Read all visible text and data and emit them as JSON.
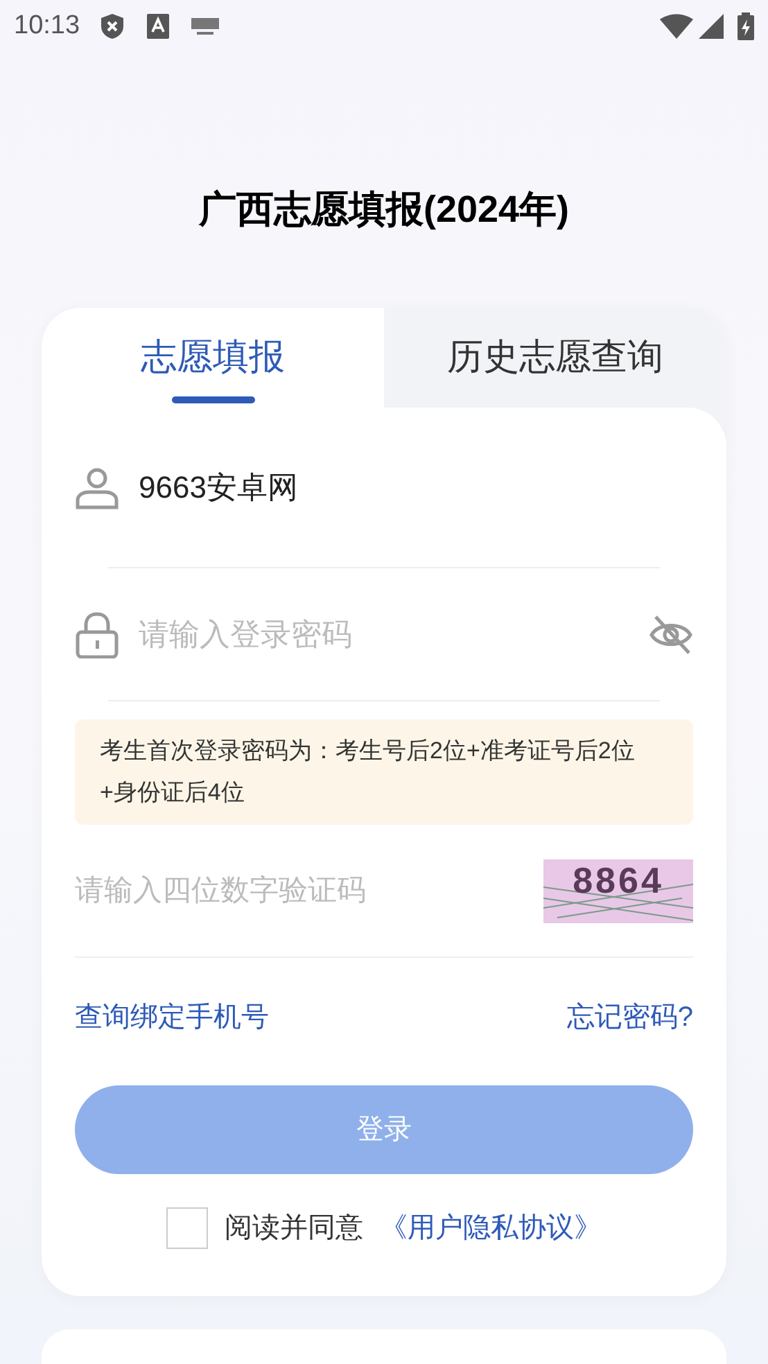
{
  "status_bar": {
    "time": "10:13"
  },
  "title": "广西志愿填报(2024年)",
  "tabs": [
    {
      "label": "志愿填报",
      "selected": true
    },
    {
      "label": "历史志愿查询",
      "selected": false
    }
  ],
  "username": {
    "value": "9663安卓网"
  },
  "password": {
    "placeholder": "请输入登录密码"
  },
  "notice": "考生首次登录密码为：考生号后2位+准考证号后2位+身份证后4位",
  "captcha": {
    "placeholder": "请输入四位数字验证码",
    "code": "8864"
  },
  "links": [
    "查询绑定手机号",
    "忘记密码?"
  ],
  "login_button": {
    "label": "登录",
    "disabled": true
  },
  "agreement": {
    "checked": false,
    "text": "阅读并同意",
    "link": "《用户隐私协议》"
  }
}
